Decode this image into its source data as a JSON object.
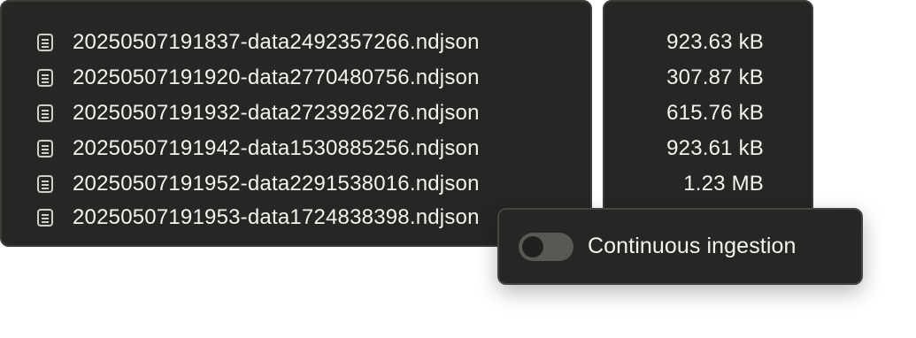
{
  "files": [
    {
      "name": "20250507191837-data2492357266.ndjson",
      "size": "923.63 kB",
      "icon": "document-icon"
    },
    {
      "name": "20250507191920-data2770480756.ndjson",
      "size": "307.87 kB",
      "icon": "document-icon"
    },
    {
      "name": "20250507191932-data2723926276.ndjson",
      "size": "615.76 kB",
      "icon": "document-icon"
    },
    {
      "name": "20250507191942-data1530885256.ndjson",
      "size": "923.61 kB",
      "icon": "document-icon"
    },
    {
      "name": "20250507191952-data2291538016.ndjson",
      "size": "1.23 MB",
      "icon": "document-icon"
    },
    {
      "name": "20250507191953-data1724838398.ndjson",
      "size": "",
      "icon": "document-icon"
    }
  ],
  "continuous_ingestion": {
    "label": "Continuous ingestion",
    "enabled": false
  },
  "colors": {
    "panel_background": "#262624",
    "panel_border": "#3c3c39",
    "text": "#f3f3ef",
    "toggle_off_track": "#585855"
  }
}
